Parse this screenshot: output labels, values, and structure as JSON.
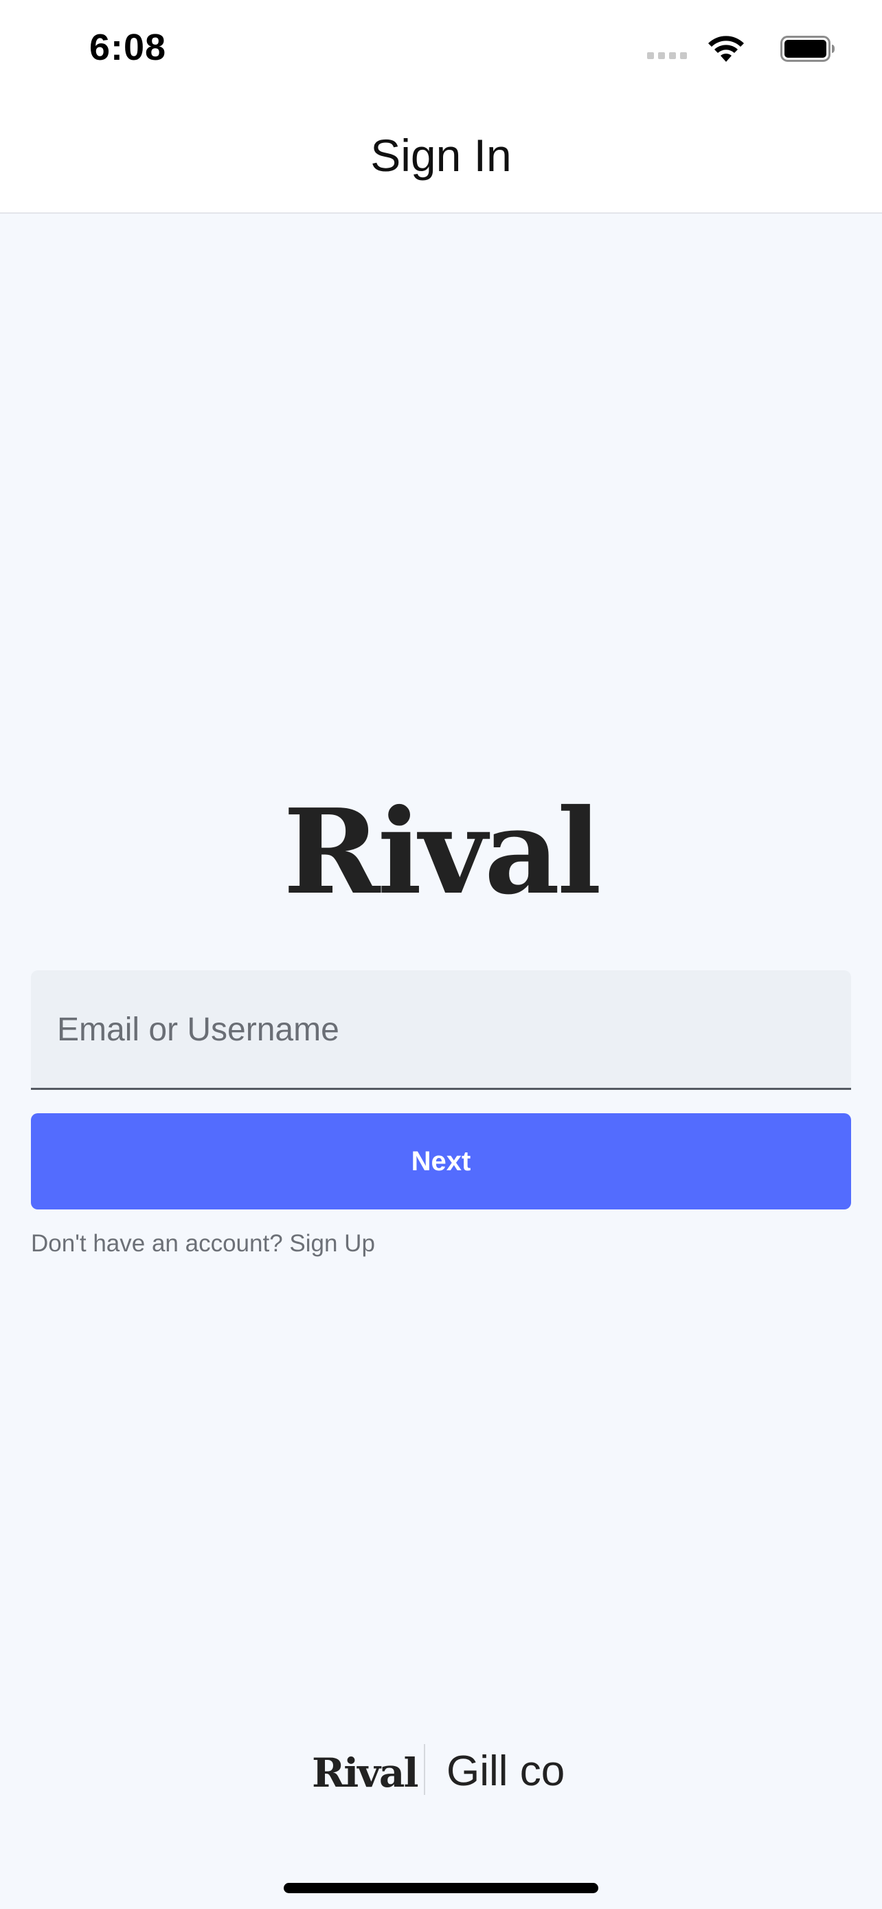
{
  "status_bar": {
    "time": "6:08",
    "icons": [
      "signal-icon",
      "wifi-icon",
      "battery-icon"
    ]
  },
  "nav": {
    "title": "Sign In"
  },
  "logo": {
    "text": "Rival"
  },
  "form": {
    "email_placeholder": "Email or Username",
    "email_value": "",
    "next_label": "Next",
    "signup_prompt": "Don't have an account?",
    "signup_link": "Sign Up"
  },
  "footer": {
    "brand": "Rival",
    "partner": "Gill co"
  },
  "colors": {
    "background": "#f5f8fd",
    "accent": "#536cfe",
    "field_background": "#ecf0f5",
    "text": "#1f1f1f",
    "muted_text": "#6c7077"
  }
}
